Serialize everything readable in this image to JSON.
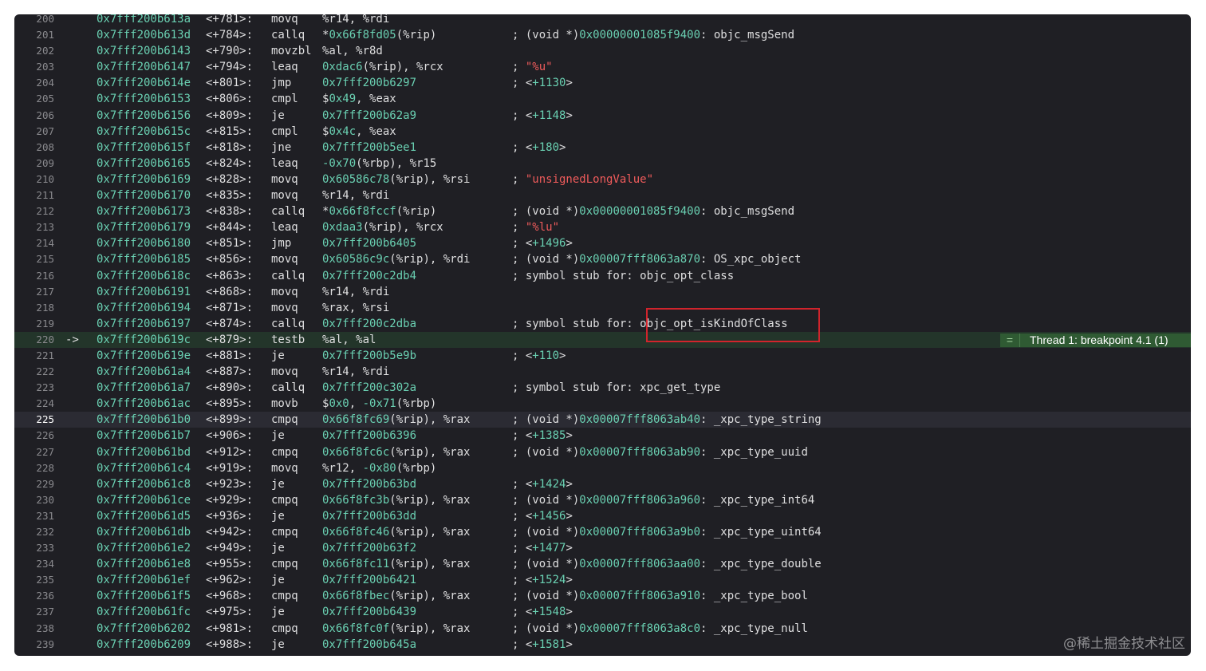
{
  "current_arrow": "->",
  "breakpoint": {
    "icon": "breakpoint-equals-icon",
    "label": "Thread 1: breakpoint 4.1 (1)"
  },
  "watermark": "@稀土掘金技术社区",
  "current_line": "220",
  "selected_line": "225",
  "lines": [
    {
      "n": "200",
      "addr": "0x7fff200b613a",
      "off": "<+781>:",
      "mn": "movq",
      "ops": [
        [
          "%r14, %rdi",
          ""
        ]
      ],
      "cm": []
    },
    {
      "n": "201",
      "addr": "0x7fff200b613d",
      "off": "<+784>:",
      "mn": "callq",
      "ops": [
        [
          "*",
          ""
        ],
        [
          "0x66f8fd05",
          "n"
        ],
        [
          "(%rip)",
          ""
        ]
      ],
      "cm": [
        [
          "; (void *)",
          ""
        ],
        [
          "0x00000001085f9400",
          "n"
        ],
        [
          ": objc_msgSend",
          ""
        ]
      ]
    },
    {
      "n": "202",
      "addr": "0x7fff200b6143",
      "off": "<+790>:",
      "mn": "movzbl",
      "ops": [
        [
          "%al, %r8d",
          ""
        ]
      ],
      "cm": []
    },
    {
      "n": "203",
      "addr": "0x7fff200b6147",
      "off": "<+794>:",
      "mn": "leaq",
      "ops": [
        [
          "0xdac6",
          "n"
        ],
        [
          "(%rip), %rcx",
          ""
        ]
      ],
      "cm": [
        [
          "; ",
          ""
        ],
        [
          "\"%u\"",
          "s"
        ]
      ]
    },
    {
      "n": "204",
      "addr": "0x7fff200b614e",
      "off": "<+801>:",
      "mn": "jmp",
      "ops": [
        [
          "0x7fff200b6297",
          "n"
        ]
      ],
      "cm": [
        [
          "; <",
          ""
        ],
        [
          "+1130",
          "n"
        ],
        [
          ">",
          ""
        ]
      ]
    },
    {
      "n": "205",
      "addr": "0x7fff200b6153",
      "off": "<+806>:",
      "mn": "cmpl",
      "ops": [
        [
          "$",
          ""
        ],
        [
          "0x49",
          "n"
        ],
        [
          ", %eax",
          ""
        ]
      ],
      "cm": []
    },
    {
      "n": "206",
      "addr": "0x7fff200b6156",
      "off": "<+809>:",
      "mn": "je",
      "ops": [
        [
          "0x7fff200b62a9",
          "n"
        ]
      ],
      "cm": [
        [
          "; <",
          ""
        ],
        [
          "+1148",
          "n"
        ],
        [
          ">",
          ""
        ]
      ]
    },
    {
      "n": "207",
      "addr": "0x7fff200b615c",
      "off": "<+815>:",
      "mn": "cmpl",
      "ops": [
        [
          "$",
          ""
        ],
        [
          "0x4c",
          "n"
        ],
        [
          ", %eax",
          ""
        ]
      ],
      "cm": []
    },
    {
      "n": "208",
      "addr": "0x7fff200b615f",
      "off": "<+818>:",
      "mn": "jne",
      "ops": [
        [
          "0x7fff200b5ee1",
          "n"
        ]
      ],
      "cm": [
        [
          "; <",
          ""
        ],
        [
          "+180",
          "n"
        ],
        [
          ">",
          ""
        ]
      ]
    },
    {
      "n": "209",
      "addr": "0x7fff200b6165",
      "off": "<+824>:",
      "mn": "leaq",
      "ops": [
        [
          "-0x70",
          "n"
        ],
        [
          "(%rbp), %r15",
          ""
        ]
      ],
      "cm": []
    },
    {
      "n": "210",
      "addr": "0x7fff200b6169",
      "off": "<+828>:",
      "mn": "movq",
      "ops": [
        [
          "0x60586c78",
          "n"
        ],
        [
          "(%rip), %rsi",
          ""
        ]
      ],
      "cm": [
        [
          "; ",
          ""
        ],
        [
          "\"unsignedLongValue\"",
          "s"
        ]
      ]
    },
    {
      "n": "211",
      "addr": "0x7fff200b6170",
      "off": "<+835>:",
      "mn": "movq",
      "ops": [
        [
          "%r14, %rdi",
          ""
        ]
      ],
      "cm": []
    },
    {
      "n": "212",
      "addr": "0x7fff200b6173",
      "off": "<+838>:",
      "mn": "callq",
      "ops": [
        [
          "*",
          ""
        ],
        [
          "0x66f8fccf",
          "n"
        ],
        [
          "(%rip)",
          ""
        ]
      ],
      "cm": [
        [
          "; (void *)",
          ""
        ],
        [
          "0x00000001085f9400",
          "n"
        ],
        [
          ": objc_msgSend",
          ""
        ]
      ]
    },
    {
      "n": "213",
      "addr": "0x7fff200b6179",
      "off": "<+844>:",
      "mn": "leaq",
      "ops": [
        [
          "0xdaa3",
          "n"
        ],
        [
          "(%rip), %rcx",
          ""
        ]
      ],
      "cm": [
        [
          "; ",
          ""
        ],
        [
          "\"%lu\"",
          "s"
        ]
      ]
    },
    {
      "n": "214",
      "addr": "0x7fff200b6180",
      "off": "<+851>:",
      "mn": "jmp",
      "ops": [
        [
          "0x7fff200b6405",
          "n"
        ]
      ],
      "cm": [
        [
          "; <",
          ""
        ],
        [
          "+1496",
          "n"
        ],
        [
          ">",
          ""
        ]
      ]
    },
    {
      "n": "215",
      "addr": "0x7fff200b6185",
      "off": "<+856>:",
      "mn": "movq",
      "ops": [
        [
          "0x60586c9c",
          "n"
        ],
        [
          "(%rip), %rdi",
          ""
        ]
      ],
      "cm": [
        [
          "; (void *)",
          ""
        ],
        [
          "0x00007fff8063a870",
          "n"
        ],
        [
          ": OS_xpc_object",
          ""
        ]
      ]
    },
    {
      "n": "216",
      "addr": "0x7fff200b618c",
      "off": "<+863>:",
      "mn": "callq",
      "ops": [
        [
          "0x7fff200c2db4",
          "n"
        ]
      ],
      "cm": [
        [
          "; symbol stub for: objc_opt_class",
          ""
        ]
      ]
    },
    {
      "n": "217",
      "addr": "0x7fff200b6191",
      "off": "<+868>:",
      "mn": "movq",
      "ops": [
        [
          "%r14, %rdi",
          ""
        ]
      ],
      "cm": []
    },
    {
      "n": "218",
      "addr": "0x7fff200b6194",
      "off": "<+871>:",
      "mn": "movq",
      "ops": [
        [
          "%rax, %rsi",
          ""
        ]
      ],
      "cm": []
    },
    {
      "n": "219",
      "addr": "0x7fff200b6197",
      "off": "<+874>:",
      "mn": "callq",
      "ops": [
        [
          "0x7fff200c2dba",
          "n"
        ]
      ],
      "cm": [
        [
          "; symbol stub for: objc_opt_isKindOfClass",
          ""
        ]
      ]
    },
    {
      "n": "220",
      "addr": "0x7fff200b619c",
      "off": "<+879>:",
      "mn": "testb",
      "ops": [
        [
          "%al, %al",
          ""
        ]
      ],
      "cm": []
    },
    {
      "n": "221",
      "addr": "0x7fff200b619e",
      "off": "<+881>:",
      "mn": "je",
      "ops": [
        [
          "0x7fff200b5e9b",
          "n"
        ]
      ],
      "cm": [
        [
          "; <",
          ""
        ],
        [
          "+110",
          "n"
        ],
        [
          ">",
          ""
        ]
      ]
    },
    {
      "n": "222",
      "addr": "0x7fff200b61a4",
      "off": "<+887>:",
      "mn": "movq",
      "ops": [
        [
          "%r14, %rdi",
          ""
        ]
      ],
      "cm": []
    },
    {
      "n": "223",
      "addr": "0x7fff200b61a7",
      "off": "<+890>:",
      "mn": "callq",
      "ops": [
        [
          "0x7fff200c302a",
          "n"
        ]
      ],
      "cm": [
        [
          "; symbol stub for: xpc_get_type",
          ""
        ]
      ]
    },
    {
      "n": "224",
      "addr": "0x7fff200b61ac",
      "off": "<+895>:",
      "mn": "movb",
      "ops": [
        [
          "$",
          ""
        ],
        [
          "0x0",
          "n"
        ],
        [
          ", ",
          ""
        ],
        [
          "-0x71",
          "n"
        ],
        [
          "(%rbp)",
          ""
        ]
      ],
      "cm": []
    },
    {
      "n": "225",
      "addr": "0x7fff200b61b0",
      "off": "<+899>:",
      "mn": "cmpq",
      "ops": [
        [
          "0x66f8fc69",
          "n"
        ],
        [
          "(%rip), %rax",
          ""
        ]
      ],
      "cm": [
        [
          "; (void *)",
          ""
        ],
        [
          "0x00007fff8063ab40",
          "n"
        ],
        [
          ": _xpc_type_string",
          ""
        ]
      ]
    },
    {
      "n": "226",
      "addr": "0x7fff200b61b7",
      "off": "<+906>:",
      "mn": "je",
      "ops": [
        [
          "0x7fff200b6396",
          "n"
        ]
      ],
      "cm": [
        [
          "; <",
          ""
        ],
        [
          "+1385",
          "n"
        ],
        [
          ">",
          ""
        ]
      ]
    },
    {
      "n": "227",
      "addr": "0x7fff200b61bd",
      "off": "<+912>:",
      "mn": "cmpq",
      "ops": [
        [
          "0x66f8fc6c",
          "n"
        ],
        [
          "(%rip), %rax",
          ""
        ]
      ],
      "cm": [
        [
          "; (void *)",
          ""
        ],
        [
          "0x00007fff8063ab90",
          "n"
        ],
        [
          ": _xpc_type_uuid",
          ""
        ]
      ]
    },
    {
      "n": "228",
      "addr": "0x7fff200b61c4",
      "off": "<+919>:",
      "mn": "movq",
      "ops": [
        [
          "%r12, ",
          ""
        ],
        [
          "-0x80",
          "n"
        ],
        [
          "(%rbp)",
          ""
        ]
      ],
      "cm": []
    },
    {
      "n": "229",
      "addr": "0x7fff200b61c8",
      "off": "<+923>:",
      "mn": "je",
      "ops": [
        [
          "0x7fff200b63bd",
          "n"
        ]
      ],
      "cm": [
        [
          "; <",
          ""
        ],
        [
          "+1424",
          "n"
        ],
        [
          ">",
          ""
        ]
      ]
    },
    {
      "n": "230",
      "addr": "0x7fff200b61ce",
      "off": "<+929>:",
      "mn": "cmpq",
      "ops": [
        [
          "0x66f8fc3b",
          "n"
        ],
        [
          "(%rip), %rax",
          ""
        ]
      ],
      "cm": [
        [
          "; (void *)",
          ""
        ],
        [
          "0x00007fff8063a960",
          "n"
        ],
        [
          ": _xpc_type_int64",
          ""
        ]
      ]
    },
    {
      "n": "231",
      "addr": "0x7fff200b61d5",
      "off": "<+936>:",
      "mn": "je",
      "ops": [
        [
          "0x7fff200b63dd",
          "n"
        ]
      ],
      "cm": [
        [
          "; <",
          ""
        ],
        [
          "+1456",
          "n"
        ],
        [
          ">",
          ""
        ]
      ]
    },
    {
      "n": "232",
      "addr": "0x7fff200b61db",
      "off": "<+942>:",
      "mn": "cmpq",
      "ops": [
        [
          "0x66f8fc46",
          "n"
        ],
        [
          "(%rip), %rax",
          ""
        ]
      ],
      "cm": [
        [
          "; (void *)",
          ""
        ],
        [
          "0x00007fff8063a9b0",
          "n"
        ],
        [
          ": _xpc_type_uint64",
          ""
        ]
      ]
    },
    {
      "n": "233",
      "addr": "0x7fff200b61e2",
      "off": "<+949>:",
      "mn": "je",
      "ops": [
        [
          "0x7fff200b63f2",
          "n"
        ]
      ],
      "cm": [
        [
          "; <",
          ""
        ],
        [
          "+1477",
          "n"
        ],
        [
          ">",
          ""
        ]
      ]
    },
    {
      "n": "234",
      "addr": "0x7fff200b61e8",
      "off": "<+955>:",
      "mn": "cmpq",
      "ops": [
        [
          "0x66f8fc11",
          "n"
        ],
        [
          "(%rip), %rax",
          ""
        ]
      ],
      "cm": [
        [
          "; (void *)",
          ""
        ],
        [
          "0x00007fff8063aa00",
          "n"
        ],
        [
          ": _xpc_type_double",
          ""
        ]
      ]
    },
    {
      "n": "235",
      "addr": "0x7fff200b61ef",
      "off": "<+962>:",
      "mn": "je",
      "ops": [
        [
          "0x7fff200b6421",
          "n"
        ]
      ],
      "cm": [
        [
          "; <",
          ""
        ],
        [
          "+1524",
          "n"
        ],
        [
          ">",
          ""
        ]
      ]
    },
    {
      "n": "236",
      "addr": "0x7fff200b61f5",
      "off": "<+968>:",
      "mn": "cmpq",
      "ops": [
        [
          "0x66f8fbec",
          "n"
        ],
        [
          "(%rip), %rax",
          ""
        ]
      ],
      "cm": [
        [
          "; (void *)",
          ""
        ],
        [
          "0x00007fff8063a910",
          "n"
        ],
        [
          ": _xpc_type_bool",
          ""
        ]
      ]
    },
    {
      "n": "237",
      "addr": "0x7fff200b61fc",
      "off": "<+975>:",
      "mn": "je",
      "ops": [
        [
          "0x7fff200b6439",
          "n"
        ]
      ],
      "cm": [
        [
          "; <",
          ""
        ],
        [
          "+1548",
          "n"
        ],
        [
          ">",
          ""
        ]
      ]
    },
    {
      "n": "238",
      "addr": "0x7fff200b6202",
      "off": "<+981>:",
      "mn": "cmpq",
      "ops": [
        [
          "0x66f8fc0f",
          "n"
        ],
        [
          "(%rip), %rax",
          ""
        ]
      ],
      "cm": [
        [
          "; (void *)",
          ""
        ],
        [
          "0x00007fff8063a8c0",
          "n"
        ],
        [
          ": _xpc_type_null",
          ""
        ]
      ]
    },
    {
      "n": "239",
      "addr": "0x7fff200b6209",
      "off": "<+988>:",
      "mn": "je",
      "ops": [
        [
          "0x7fff200b645a",
          "n"
        ]
      ],
      "cm": [
        [
          "; <",
          ""
        ],
        [
          "+1581",
          "n"
        ],
        [
          ">",
          ""
        ]
      ]
    }
  ]
}
